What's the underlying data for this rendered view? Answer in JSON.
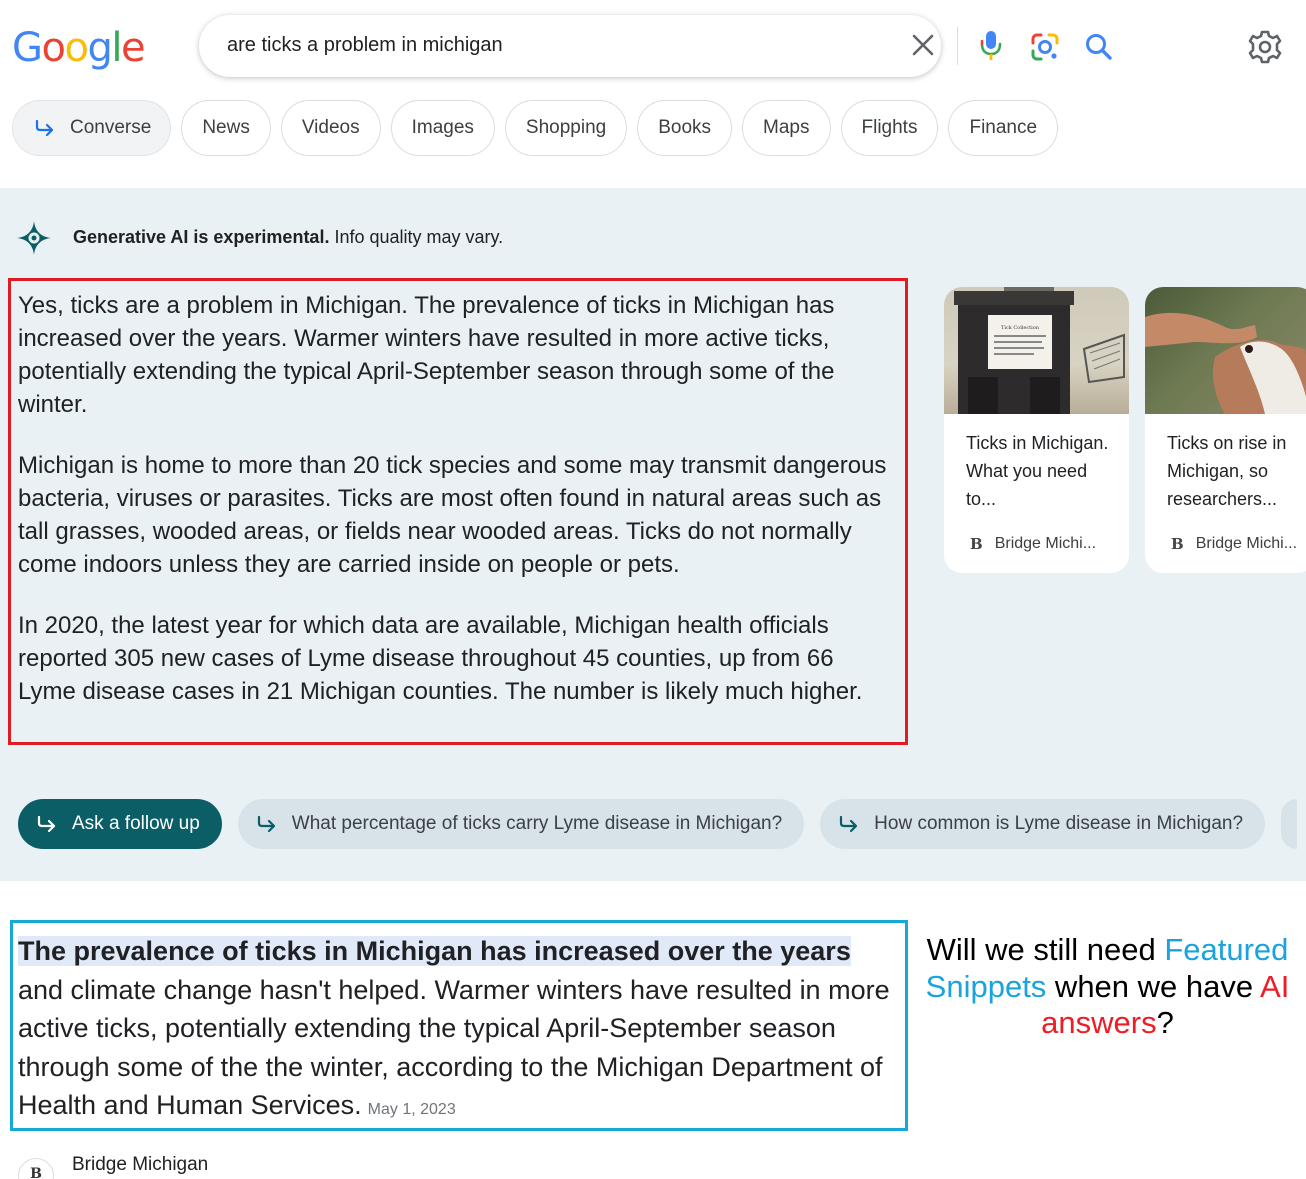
{
  "logo": {
    "text": "Google",
    "letters": [
      "G",
      "o",
      "o",
      "g",
      "l",
      "e"
    ],
    "colors": [
      "#4285f4",
      "#ea4335",
      "#fbbc05",
      "#4285f4",
      "#34a853",
      "#ea4335"
    ]
  },
  "search": {
    "query": "are ticks a problem in michigan"
  },
  "tabs": [
    {
      "label": "Converse",
      "icon": "follow-up-arrow-icon"
    },
    {
      "label": "News"
    },
    {
      "label": "Videos"
    },
    {
      "label": "Images"
    },
    {
      "label": "Shopping"
    },
    {
      "label": "Books"
    },
    {
      "label": "Maps"
    },
    {
      "label": "Flights"
    },
    {
      "label": "Finance"
    }
  ],
  "ai": {
    "disclaimer_bold": "Generative AI is experimental.",
    "disclaimer_rest": " Info quality may vary.",
    "paragraphs": [
      "Yes, ticks are a problem in Michigan. The prevalence of ticks in Michigan has increased over the years. Warmer winters have resulted in more active ticks, potentially extending the typical April-September season through some of the winter.",
      "Michigan is home to more than 20 tick species and some may transmit dangerous bacteria, viruses or parasites. Ticks are most often found in natural areas such as tall grasses, wooded areas, or fields near wooded areas. Ticks do not normally come indoors unless they are carried inside on people or pets.",
      "In 2020, the latest year for which data are available, Michigan health officials reported 305 new cases of Lyme disease throughout 45 counties, up from 66 Lyme disease cases in 21 Michigan counties. The number is likely much higher."
    ],
    "cards": [
      {
        "title": "Ticks in Michigan. What you need to...",
        "source": "Bridge Michi...",
        "source_icon": "B",
        "image_label": "Tick Collection"
      },
      {
        "title": "Ticks on rise in Michigan, so researchers...",
        "source": "Bridge Michi...",
        "source_icon": "B"
      }
    ],
    "ask_followup": "Ask a follow up",
    "suggestions": [
      "What percentage of ticks carry Lyme disease in Michigan?",
      "How common is Lyme disease in Michigan?"
    ]
  },
  "snippet": {
    "highlight": "The prevalence of ticks in Michigan has increased over the years",
    "text": " and climate change hasn't helped. Warmer winters have resulted in more active ticks, potentially extending the typical April-September season through some of the the winter, according to the Michigan Department of Health and Human Services.",
    "date": "May 1, 2023",
    "source": "Bridge Michigan",
    "source_icon": "B"
  },
  "annotation": {
    "part1": "Will we still need ",
    "part2": "Featured Snippets",
    "part3": " when we have ",
    "part4": "AI answers",
    "part5": "?",
    "colors": {
      "blue": "#1aa3dc",
      "red": "#ee1c25"
    }
  },
  "colors": {
    "ai_panel_bg": "#eaf1f4",
    "ask_button": "#0b5e66",
    "ai_outline": "#e01b24",
    "snippet_outline": "#17a8d8"
  }
}
